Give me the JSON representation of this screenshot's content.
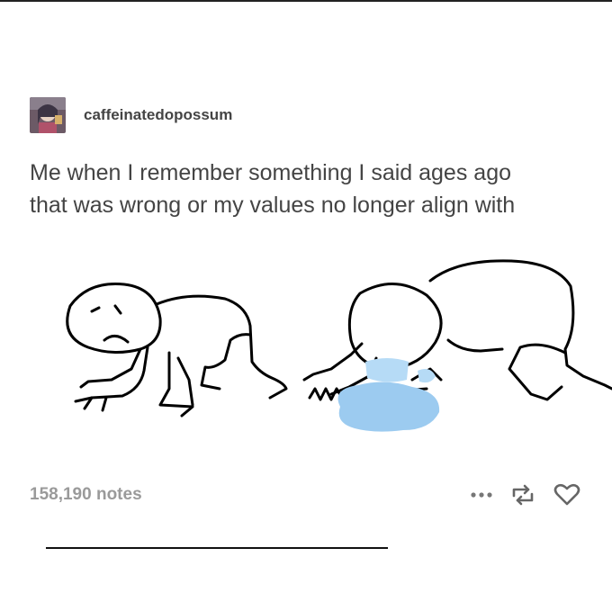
{
  "post": {
    "username": "caffeinatedopossum",
    "caption_lines": [
      "Me when I remember something I said ages ago",
      "that was wrong or my values no longer align with"
    ],
    "notes": "158,190 notes"
  },
  "actions": {
    "more_icon": "ellipsis-icon",
    "reblog_icon": "reblog-icon",
    "like_icon": "heart-icon"
  },
  "colors": {
    "text": "#444444",
    "muted": "#9a9a9a",
    "vomit": "#9ccbf0"
  }
}
